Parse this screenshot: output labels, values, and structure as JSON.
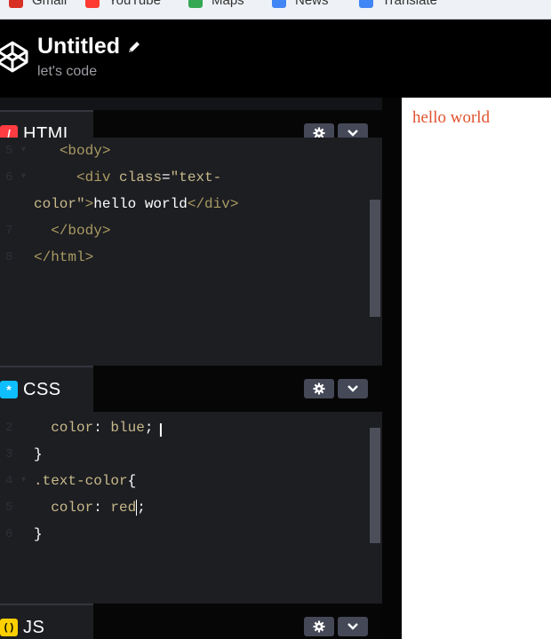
{
  "bookmarks": [
    {
      "label": "Gmail",
      "icon": "gmail-icon",
      "color": "#d93025"
    },
    {
      "label": "YouTube",
      "icon": "youtube-icon",
      "color": "#ff0000"
    },
    {
      "label": "Maps",
      "icon": "maps-icon",
      "color": "#34a853"
    },
    {
      "label": "News",
      "icon": "news-icon",
      "color": "#4285f4"
    },
    {
      "label": "Translate",
      "icon": "translate-icon",
      "color": "#4285f4"
    }
  ],
  "header": {
    "title": "Untitled",
    "subtitle": "let's code",
    "logo_icon": "codepen-logo-icon",
    "edit_icon": "pencil-icon"
  },
  "editors": {
    "html": {
      "label": "HTML",
      "icon_glyph": "/",
      "icon_color": "#ff3c41",
      "lines": [
        {
          "num": "5",
          "fold": "▾",
          "segments": [
            {
              "t": "   ",
              "c": "plain"
            },
            {
              "t": "<body>",
              "c": "tag"
            }
          ]
        },
        {
          "num": "6",
          "fold": "▾",
          "segments": [
            {
              "t": "     ",
              "c": "plain"
            },
            {
              "t": "<div ",
              "c": "tag"
            },
            {
              "t": "class",
              "c": "attr"
            },
            {
              "t": "=",
              "c": "punc"
            },
            {
              "t": "\"text-",
              "c": "str"
            }
          ]
        },
        {
          "num": "",
          "fold": "",
          "segments": [
            {
              "t": "color\"",
              "c": "str"
            },
            {
              "t": ">",
              "c": "tag"
            },
            {
              "t": "hello world",
              "c": "plain"
            },
            {
              "t": "</div>",
              "c": "tag"
            }
          ]
        },
        {
          "num": "7",
          "fold": "",
          "segments": [
            {
              "t": "  ",
              "c": "plain"
            },
            {
              "t": "</body>",
              "c": "tag"
            }
          ]
        },
        {
          "num": "8",
          "fold": "",
          "segments": [
            {
              "t": "</html>",
              "c": "tag"
            }
          ]
        }
      ]
    },
    "css": {
      "label": "CSS",
      "icon_glyph": "*",
      "icon_color": "#0ebeff",
      "lines": [
        {
          "num": "2",
          "fold": "",
          "segments": [
            {
              "t": "  ",
              "c": "plain"
            },
            {
              "t": "color",
              "c": "prop"
            },
            {
              "t": ": ",
              "c": "punc"
            },
            {
              "t": "blue",
              "c": "val"
            },
            {
              "t": ";",
              "c": "punc"
            }
          ]
        },
        {
          "num": "3",
          "fold": "",
          "segments": [
            {
              "t": "}",
              "c": "punc"
            }
          ]
        },
        {
          "num": "4",
          "fold": "▾",
          "segments": [
            {
              "t": ".text-color",
              "c": "sel"
            },
            {
              "t": "{",
              "c": "punc"
            }
          ]
        },
        {
          "num": "5",
          "fold": "",
          "segments": [
            {
              "t": "  ",
              "c": "plain"
            },
            {
              "t": "color",
              "c": "prop"
            },
            {
              "t": ": ",
              "c": "punc"
            },
            {
              "t": "red",
              "c": "val"
            },
            {
              "t": "|",
              "c": "caret"
            },
            {
              "t": ";",
              "c": "punc"
            }
          ]
        },
        {
          "num": "6",
          "fold": "",
          "segments": [
            {
              "t": "}",
              "c": "punc"
            }
          ]
        }
      ]
    },
    "js": {
      "label": "JS",
      "icon_glyph": "( )",
      "icon_color": "#fcd000"
    }
  },
  "preview": {
    "text": "hello world",
    "text_color": "#e0522e"
  }
}
